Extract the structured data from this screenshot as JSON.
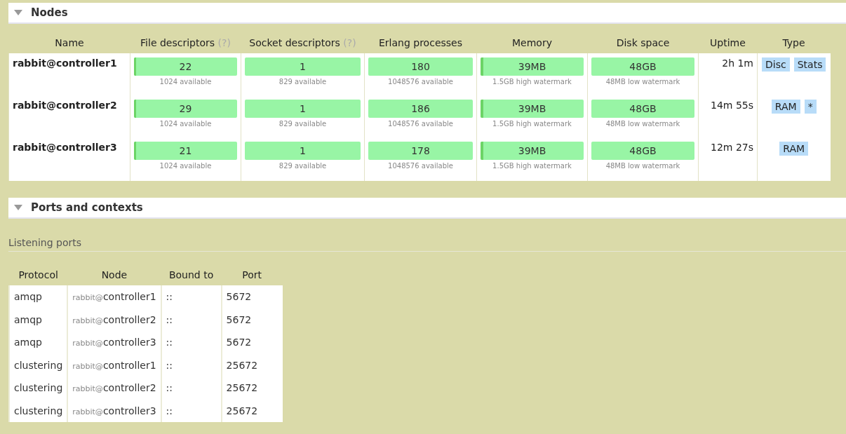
{
  "nodes_section": {
    "title": "Nodes",
    "expanded": true,
    "columns": [
      {
        "label": "Name"
      },
      {
        "label": "File descriptors",
        "help": "(?)"
      },
      {
        "label": "Socket descriptors",
        "help": "(?)"
      },
      {
        "label": "Erlang processes"
      },
      {
        "label": "Memory"
      },
      {
        "label": "Disk space"
      },
      {
        "label": "Uptime"
      },
      {
        "label": "Type"
      }
    ],
    "rows": [
      {
        "name": "rabbit@controller1",
        "metrics": [
          {
            "value": "22",
            "level": 0.02,
            "note": "1024 available"
          },
          {
            "value": "1",
            "note": "829 available"
          },
          {
            "value": "180",
            "note": "1048576 available"
          },
          {
            "value": "39MB",
            "level": 0.025,
            "note": "1.5GB high watermark"
          },
          {
            "value": "48GB",
            "note": "48MB low watermark"
          }
        ],
        "uptime": "2h 1m",
        "types": [
          "Disc",
          "Stats"
        ]
      },
      {
        "name": "rabbit@controller2",
        "metrics": [
          {
            "value": "29",
            "level": 0.02,
            "note": "1024 available"
          },
          {
            "value": "1",
            "note": "829 available"
          },
          {
            "value": "186",
            "note": "1048576 available"
          },
          {
            "value": "39MB",
            "level": 0.025,
            "note": "1.5GB high watermark"
          },
          {
            "value": "48GB",
            "note": "48MB low watermark"
          }
        ],
        "uptime": "14m 55s",
        "types": [
          "RAM",
          "*"
        ]
      },
      {
        "name": "rabbit@controller3",
        "metrics": [
          {
            "value": "21",
            "level": 0.02,
            "note": "1024 available"
          },
          {
            "value": "1",
            "note": "829 available"
          },
          {
            "value": "178",
            "note": "1048576 available"
          },
          {
            "value": "39MB",
            "level": 0.025,
            "note": "1.5GB high watermark"
          },
          {
            "value": "48GB",
            "note": "48MB low watermark"
          }
        ],
        "uptime": "12m 27s",
        "types": [
          "RAM"
        ]
      }
    ]
  },
  "ports_section": {
    "title": "Ports and contexts",
    "expanded": true,
    "subtitle": "Listening ports",
    "columns": [
      "Protocol",
      "Node",
      "Bound to",
      "Port"
    ],
    "rows": [
      {
        "protocol": "amqp",
        "node": {
          "prefix": "rabbit@",
          "host": "controller1"
        },
        "bound_to": "::",
        "port": "5672"
      },
      {
        "protocol": "amqp",
        "node": {
          "prefix": "rabbit@",
          "host": "controller2"
        },
        "bound_to": "::",
        "port": "5672"
      },
      {
        "protocol": "amqp",
        "node": {
          "prefix": "rabbit@",
          "host": "controller3"
        },
        "bound_to": "::",
        "port": "5672"
      },
      {
        "protocol": "clustering",
        "node": {
          "prefix": "rabbit@",
          "host": "controller1"
        },
        "bound_to": "::",
        "port": "25672"
      },
      {
        "protocol": "clustering",
        "node": {
          "prefix": "rabbit@",
          "host": "controller2"
        },
        "bound_to": "::",
        "port": "25672"
      },
      {
        "protocol": "clustering",
        "node": {
          "prefix": "rabbit@",
          "host": "controller3"
        },
        "bound_to": "::",
        "port": "25672"
      }
    ]
  }
}
